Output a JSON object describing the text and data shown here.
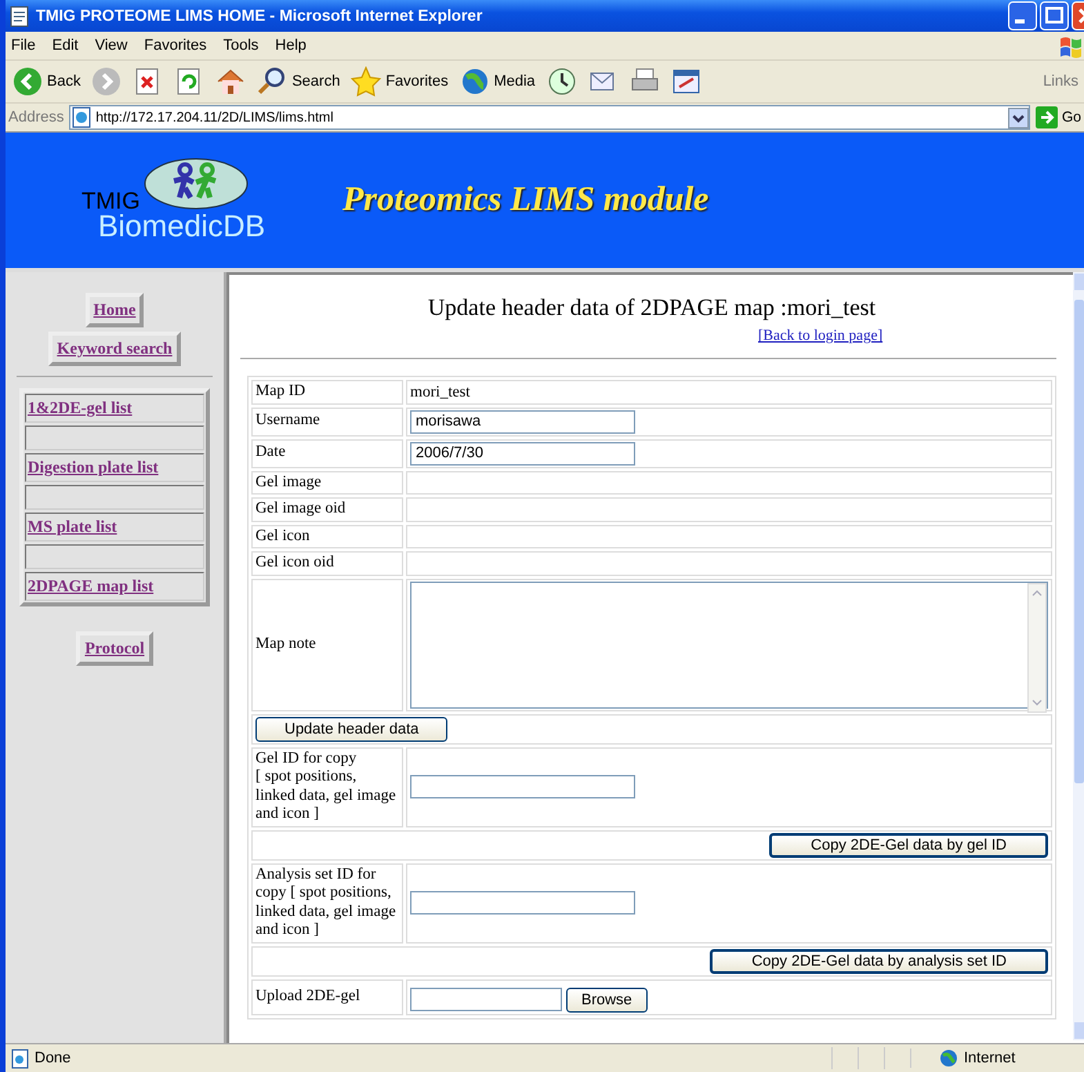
{
  "window": {
    "title": "TMIG PROTEOME LIMS HOME - Microsoft Internet Explorer"
  },
  "menu": [
    "File",
    "Edit",
    "View",
    "Favorites",
    "Tools",
    "Help"
  ],
  "toolbar": [
    {
      "kind": "back",
      "label": "Back"
    },
    {
      "kind": "forward"
    },
    {
      "kind": "stop"
    },
    {
      "kind": "refresh"
    },
    {
      "kind": "home"
    },
    {
      "kind": "search",
      "label": "Search"
    },
    {
      "kind": "favorites",
      "label": "Favorites"
    },
    {
      "kind": "media",
      "label": "Media"
    },
    {
      "kind": "history"
    },
    {
      "kind": "mail"
    },
    {
      "kind": "print"
    },
    {
      "kind": "edit"
    }
  ],
  "links_label": "Links",
  "address": {
    "label": "Address",
    "url": "http://172.17.204.11/2D/LIMS/lims.html",
    "go": "Go"
  },
  "banner": {
    "logo_top": "TMIG",
    "logo_bottom": "BiomedicDB",
    "title": "Proteomics LIMS module"
  },
  "sidebar": {
    "top_links": [
      "Home",
      "Keyword search"
    ],
    "list_links": [
      "1&2DE-gel list",
      "Digestion plate list",
      "MS plate list",
      "2DPAGE map list"
    ],
    "bottom_links": [
      "Protocol"
    ]
  },
  "content": {
    "heading": "Update header data of 2DPAGE map :mori_test",
    "back_link": "[Back to login page]",
    "rows": [
      {
        "kind": "text",
        "label": "Map ID",
        "value": "mori_test"
      },
      {
        "kind": "input",
        "label": "Username",
        "value": "morisawa"
      },
      {
        "kind": "input",
        "label": "Date",
        "value": "2006/7/30"
      },
      {
        "kind": "empty",
        "label": "Gel image"
      },
      {
        "kind": "empty",
        "label": "Gel image oid"
      },
      {
        "kind": "empty",
        "label": "Gel icon"
      },
      {
        "kind": "empty",
        "label": "Gel icon oid"
      },
      {
        "kind": "textarea",
        "label": "Map note"
      },
      {
        "kind": "left_button",
        "button": "Update header data"
      },
      {
        "kind": "input",
        "label": "Gel ID for copy\n[ spot positions, linked data, gel image and icon ]"
      },
      {
        "kind": "right_button",
        "button": "Copy 2DE-Gel data by gel ID"
      },
      {
        "kind": "input",
        "label": "Analysis set ID for copy [ spot positions, linked data, gel image and icon ]"
      },
      {
        "kind": "right_button",
        "button": "Copy 2DE-Gel data by analysis set ID"
      },
      {
        "kind": "file",
        "label": "Upload 2DE-gel",
        "button": "Browse"
      }
    ]
  },
  "status_bar": {
    "text": "Done",
    "zone": "Internet"
  }
}
